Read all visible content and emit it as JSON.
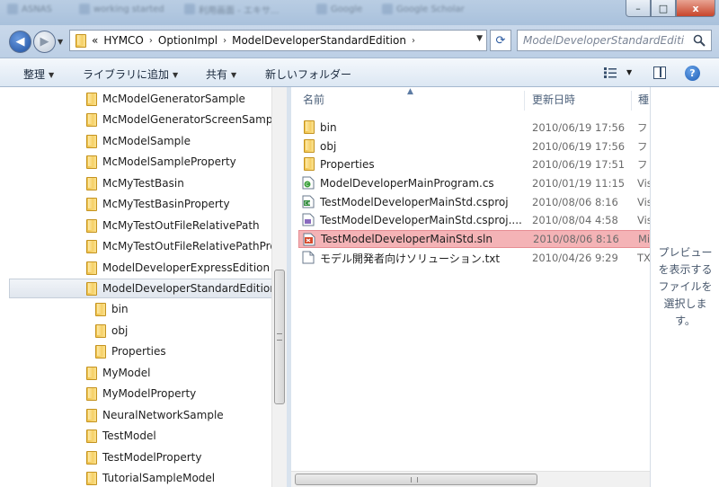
{
  "window": {
    "blur_tabs": [
      "ASNAS",
      "working started",
      "利用画面 - エキサ...",
      "Google",
      "Google Scholar"
    ],
    "controls": {
      "minimize": "–",
      "maximize": "□",
      "close": "x"
    }
  },
  "address": {
    "overflow": "«",
    "crumbs": [
      "HYMCO",
      "OptionImpl",
      "ModelDeveloperStandardEdition"
    ],
    "search_placeholder": "ModelDeveloperStandardEditi..."
  },
  "toolbar": {
    "organize": "整理",
    "add_library": "ライブラリに追加",
    "share": "共有",
    "new_folder": "新しいフォルダー"
  },
  "tree": {
    "items": [
      {
        "label": "McModelGeneratorSample",
        "level": 0
      },
      {
        "label": "McModelGeneratorScreenSample",
        "level": 0
      },
      {
        "label": "McModelSample",
        "level": 0
      },
      {
        "label": "McModelSampleProperty",
        "level": 0
      },
      {
        "label": "McMyTestBasin",
        "level": 0
      },
      {
        "label": "McMyTestBasinProperty",
        "level": 0
      },
      {
        "label": "McMyTestOutFileRelativePath",
        "level": 0
      },
      {
        "label": "McMyTestOutFileRelativePathProperty",
        "level": 0
      },
      {
        "label": "ModelDeveloperExpressEdition",
        "level": 0
      },
      {
        "label": "ModelDeveloperStandardEdition",
        "level": 0,
        "selected": true
      },
      {
        "label": "bin",
        "level": 1
      },
      {
        "label": "obj",
        "level": 1
      },
      {
        "label": "Properties",
        "level": 1
      },
      {
        "label": "MyModel",
        "level": 0
      },
      {
        "label": "MyModelProperty",
        "level": 0
      },
      {
        "label": "NeuralNetworkSample",
        "level": 0
      },
      {
        "label": "TestModel",
        "level": 0
      },
      {
        "label": "TestModelProperty",
        "level": 0
      },
      {
        "label": "TutorialSampleModel",
        "level": 0
      }
    ]
  },
  "columns": {
    "name": "名前",
    "date": "更新日時",
    "type": "種"
  },
  "files": [
    {
      "name": "bin",
      "date": "2010/06/19 17:56",
      "type": "フ",
      "icon": "folder-icon"
    },
    {
      "name": "obj",
      "date": "2010/06/19 17:56",
      "type": "フ",
      "icon": "folder-icon"
    },
    {
      "name": "Properties",
      "date": "2010/06/19 17:51",
      "type": "フ",
      "icon": "folder-icon"
    },
    {
      "name": "ModelDeveloperMainProgram.cs",
      "date": "2010/01/19 11:15",
      "type": "Vis",
      "icon": "csharp-file-icon"
    },
    {
      "name": "TestModelDeveloperMainStd.csproj",
      "date": "2010/08/06 8:16",
      "type": "Vis",
      "icon": "csproj-file-icon"
    },
    {
      "name": "TestModelDeveloperMainStd.csproj....",
      "date": "2010/08/04 4:58",
      "type": "Vis",
      "icon": "user-file-icon"
    },
    {
      "name": "TestModelDeveloperMainStd.sln",
      "date": "2010/08/06 8:16",
      "type": "Mi",
      "icon": "solution-file-icon",
      "highlight": true
    },
    {
      "name": "モデル開発者向けソリューション.txt",
      "date": "2010/04/26 9:29",
      "type": "TX",
      "icon": "text-file-icon"
    }
  ],
  "preview": {
    "message": "プレビュー\nを表示する\nファイルを\n選択しま\nす。"
  },
  "colors": {
    "highlight": "#f4b3b6",
    "accent": "#1d5cb4"
  }
}
